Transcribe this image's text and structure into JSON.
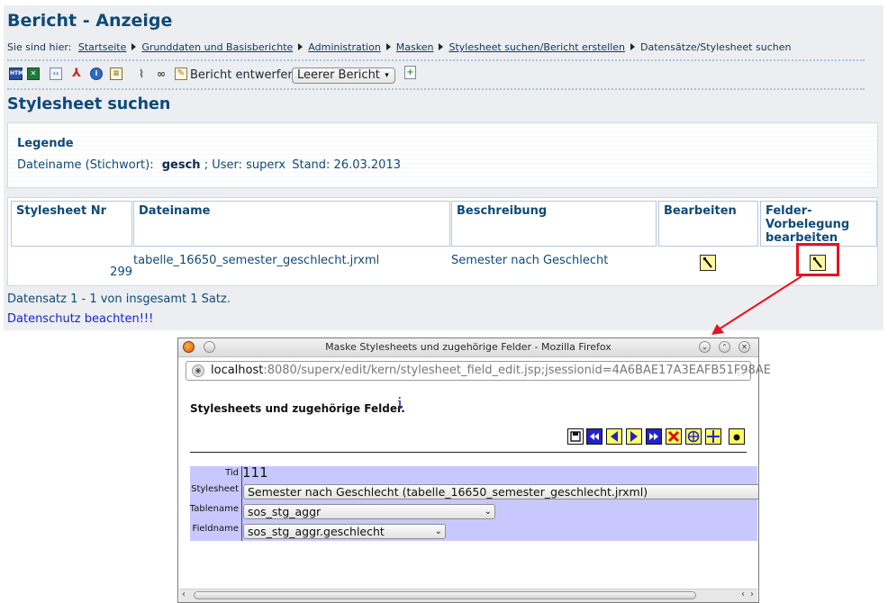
{
  "page": {
    "title": "Bericht - Anzeige",
    "breadcrumb_prefix": "Sie sind hier:",
    "breadcrumb_links": [
      "Startseite",
      "Grunddaten und Basisberichte",
      "Administration",
      "Masken",
      "Stylesheet suchen/Bericht erstellen"
    ],
    "breadcrumb_current": "Datensätze/Stylesheet suchen"
  },
  "toolbar": {
    "icons": [
      "html-export-icon",
      "excel-export-icon",
      "xml-export-icon",
      "pdf-export-icon",
      "info-icon",
      "text-export-icon",
      "paperclip-icon",
      "link-icon",
      "edit-icon",
      "new-report-icon"
    ],
    "html_label": "HTML",
    "report_label": "Bericht entwerfen:",
    "report_select_value": "Leerer Bericht"
  },
  "section": {
    "title": "Stylesheet suchen"
  },
  "legend": {
    "title": "Legende",
    "filename_label": "Dateiname (Stichwort):",
    "filename_value": "gesch",
    "user_text": "; User: superx",
    "stand_text": "Stand: 26.03.2013"
  },
  "table": {
    "headers": [
      "Stylesheet Nr",
      "Dateiname",
      "Beschreibung",
      "Bearbeiten",
      "Felder-Vorbelegung bearbeiten"
    ],
    "header_lines": {
      "felder_1": "Felder-",
      "felder_2": "Vorbelegung",
      "felder_3": "bearbeiten"
    },
    "rows": [
      {
        "nr": "299",
        "dateiname": "tabelle_16650_semester_geschlecht.jrxml",
        "beschreibung": "Semester nach Geschlecht"
      }
    ]
  },
  "status": "Datensatz 1 - 1 von insgesamt 1 Satz.",
  "privacy_link": "Datenschutz beachten!!!",
  "popup": {
    "window_title": "Maske Stylesheets und zugehörige Felder - Mozilla Firefox",
    "url_host": "localhost",
    "url_rest": ":8080/superx/edit/kern/stylesheet_field_edit.jsp;jsessionid=4A6BAE17A3EAFB51F98AE",
    "heading": "Stylesheets und zugehörige Felder.",
    "info_glyph": "i",
    "nav_buttons": [
      "save-icon",
      "first-record-icon",
      "previous-record-icon",
      "next-record-icon",
      "last-record-icon",
      "delete-icon",
      "search-icon",
      "add-icon",
      "execute-icon"
    ],
    "fields": [
      {
        "label": "Tid",
        "value": "111"
      },
      {
        "label": "Stylesheet",
        "value": "Semester nach Geschlecht (tabelle_16650_semester_geschlecht.jrxml)"
      },
      {
        "label": "Tablename",
        "value": "sos_stg_aggr"
      },
      {
        "label": "Fieldname",
        "value": "sos_stg_aggr.geschlecht"
      }
    ]
  },
  "colors": {
    "highlight": "#e8141c",
    "title_blue": "#0e4a78",
    "form_bg": "#c8c8ff",
    "button_yellow": "#fff7a0"
  }
}
